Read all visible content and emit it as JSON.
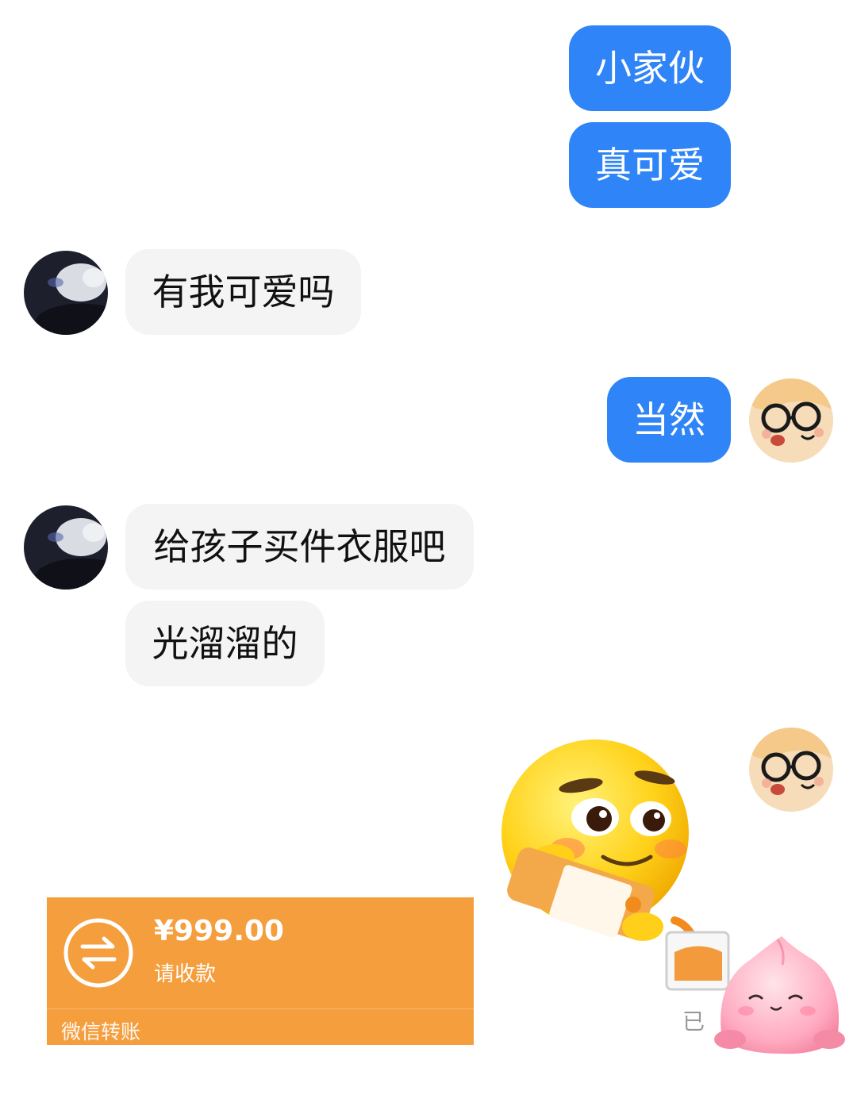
{
  "messages": {
    "m1": "小家伙",
    "m2": "真可爱",
    "m3": "有我可爱吗",
    "m4": "当然",
    "m5": "给孩子买件衣服吧",
    "m6": "光溜溜的"
  },
  "transfer": {
    "amount": "¥999.00",
    "note": "请收款",
    "footer": "微信转账",
    "icon": "transfer-arrows-icon"
  },
  "status": {
    "label": "已"
  },
  "colors": {
    "my_bubble": "#2f84f7",
    "their_bubble": "#f4f4f4",
    "transfer_card": "#f59e3d"
  },
  "stickers": [
    "smiley-pouring-orange-juice",
    "pink-peach-character"
  ]
}
